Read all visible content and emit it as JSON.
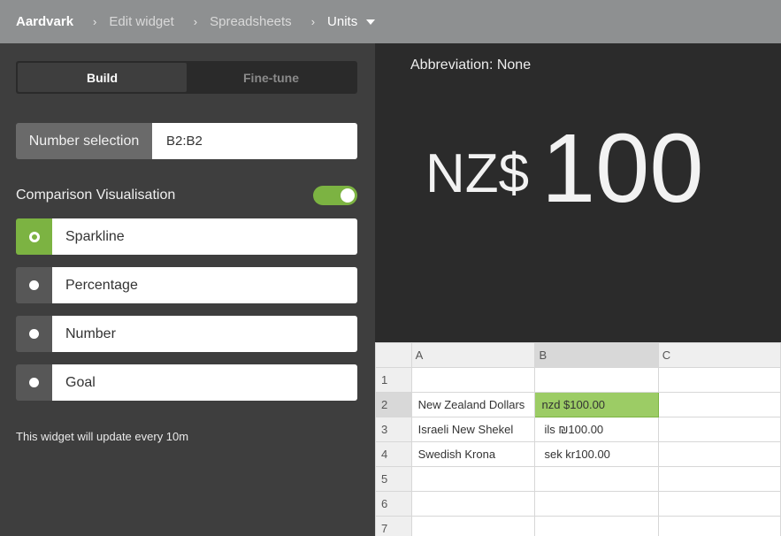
{
  "breadcrumb": {
    "brand": "Aardvark",
    "items": [
      "Edit widget",
      "Spreadsheets"
    ],
    "current": "Units",
    "separator": "›"
  },
  "tabs": [
    {
      "label": "Build",
      "active": true
    },
    {
      "label": "Fine-tune",
      "active": false
    }
  ],
  "number_selection": {
    "label": "Number selection",
    "value": "B2:B2"
  },
  "comparison": {
    "label": "Comparison Visualisation",
    "enabled": true,
    "options": [
      {
        "label": "Sparkline",
        "selected": true
      },
      {
        "label": "Percentage",
        "selected": false
      },
      {
        "label": "Number",
        "selected": false
      },
      {
        "label": "Goal",
        "selected": false
      }
    ]
  },
  "update_note": "This widget will update every 10m",
  "preview": {
    "abbreviation": "Abbreviation: None",
    "currency": "NZ$",
    "value": "100"
  },
  "sheet": {
    "columns": [
      "A",
      "B",
      "C"
    ],
    "rows": [
      {
        "num": "1",
        "a": "",
        "b": "",
        "c": ""
      },
      {
        "num": "2",
        "a": "New Zealand Dollars",
        "b": "nzd $100.00",
        "c": ""
      },
      {
        "num": "3",
        "a": "Israeli New Shekel",
        "b": "ils ₪100.00",
        "c": ""
      },
      {
        "num": "4",
        "a": "Swedish Krona",
        "b": "sek kr100.00",
        "c": ""
      },
      {
        "num": "5",
        "a": "",
        "b": "",
        "c": ""
      },
      {
        "num": "6",
        "a": "",
        "b": "",
        "c": ""
      },
      {
        "num": "7",
        "a": "",
        "b": "",
        "c": ""
      }
    ]
  },
  "colors": {
    "accent": "#7cb342",
    "topbar": "#8e9091",
    "panel": "#3e3e3e",
    "preview": "#2b2b2b"
  },
  "icons": {
    "separator": "chevron-right-icon",
    "dropdown": "caret-down-icon"
  }
}
